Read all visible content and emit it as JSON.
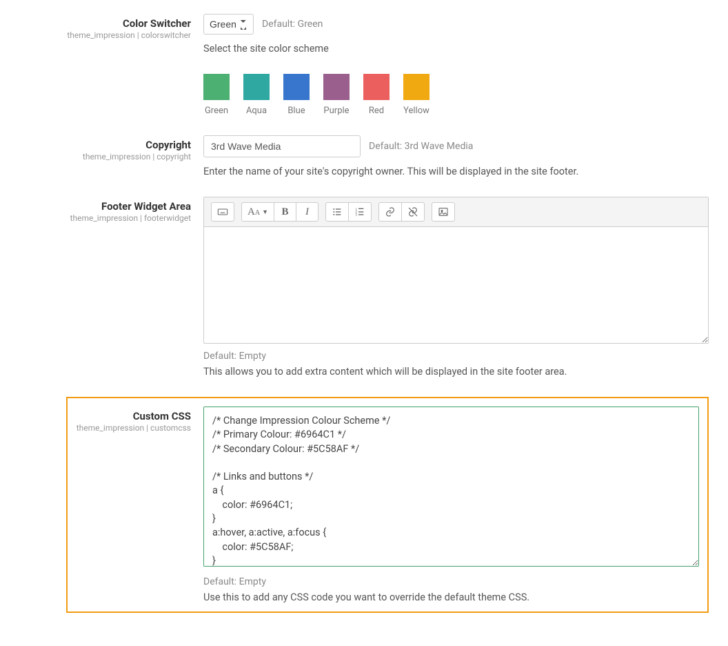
{
  "color_switcher": {
    "label": "Color Switcher",
    "sub": "theme_impression | colorswitcher",
    "value": "Green",
    "default": "Default: Green",
    "help": "Select the site color scheme",
    "swatches": [
      {
        "name": "Green",
        "hex": "#4bb072"
      },
      {
        "name": "Aqua",
        "hex": "#2fa8a2"
      },
      {
        "name": "Blue",
        "hex": "#3875cd"
      },
      {
        "name": "Purple",
        "hex": "#9a5f8d"
      },
      {
        "name": "Red",
        "hex": "#ec5f5f"
      },
      {
        "name": "Yellow",
        "hex": "#f1a912"
      }
    ]
  },
  "copyright": {
    "label": "Copyright",
    "sub": "theme_impression | copyright",
    "value": "3rd Wave Media",
    "default": "Default: 3rd Wave Media",
    "help": "Enter the name of your site's copyright owner. This will be displayed in the site footer."
  },
  "footer_widget": {
    "label": "Footer Widget Area",
    "sub": "theme_impression | footerwidget",
    "default": "Default: Empty",
    "help": "This allows you to add extra content which will be displayed in the site footer area.",
    "toolbar_icons": {
      "keyboard": "keyboard-icon",
      "font": "font-size-icon",
      "bold": "bold-icon",
      "italic": "italic-icon",
      "ul": "unordered-list-icon",
      "ol": "ordered-list-icon",
      "link": "link-icon",
      "unlink": "unlink-icon",
      "image": "image-icon"
    }
  },
  "custom_css": {
    "label": "Custom CSS",
    "sub": "theme_impression | customcss",
    "value": "/* Change Impression Colour Scheme */\n/* Primary Colour: #6964C1 */\n/* Secondary Colour: #5C58AF */\n\n/* Links and buttons */\na {\n    color: #6964C1;\n}\na:hover, a:active, a:focus {\n    color: #5C58AF;\n}",
    "default": "Default: Empty",
    "help": "Use this to add any CSS code you want to override the default theme CSS."
  }
}
